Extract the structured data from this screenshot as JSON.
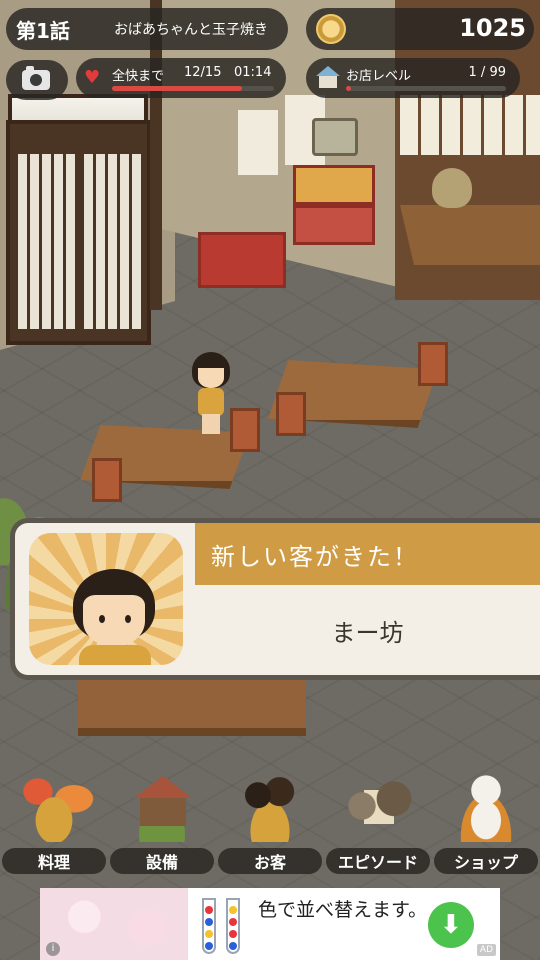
{
  "header": {
    "episode_number": "第1話",
    "episode_title": "おばあちゃんと玉子焼き",
    "coins": "1025"
  },
  "status": {
    "recovery_label": "全快まで",
    "recovery_count": "12/15",
    "recovery_timer": "01:14",
    "recovery_progress": 0.8,
    "shop_level_label": "お店レベル",
    "shop_level_value": "1 / 99",
    "shop_level_progress": 0.01
  },
  "notification": {
    "title": "新しい客がきた！",
    "customer_name": "まー坊"
  },
  "menu": [
    {
      "label": "料理",
      "icon": "cooking-icon"
    },
    {
      "label": "設備",
      "icon": "equipment-icon"
    },
    {
      "label": "お客",
      "icon": "customers-icon"
    },
    {
      "label": "エピソード",
      "icon": "episode-icon"
    },
    {
      "label": "ショップ",
      "icon": "shop-icon"
    }
  ],
  "ad": {
    "text": "色で並べ替えます。",
    "badge": "AD",
    "info": "i",
    "cta_icon": "⬇"
  },
  "colors": {
    "accent_gold": "#cf9b45",
    "hud_dark": "#28261f",
    "bar_red": "#d94a43",
    "ad_green": "#4cc34c"
  }
}
